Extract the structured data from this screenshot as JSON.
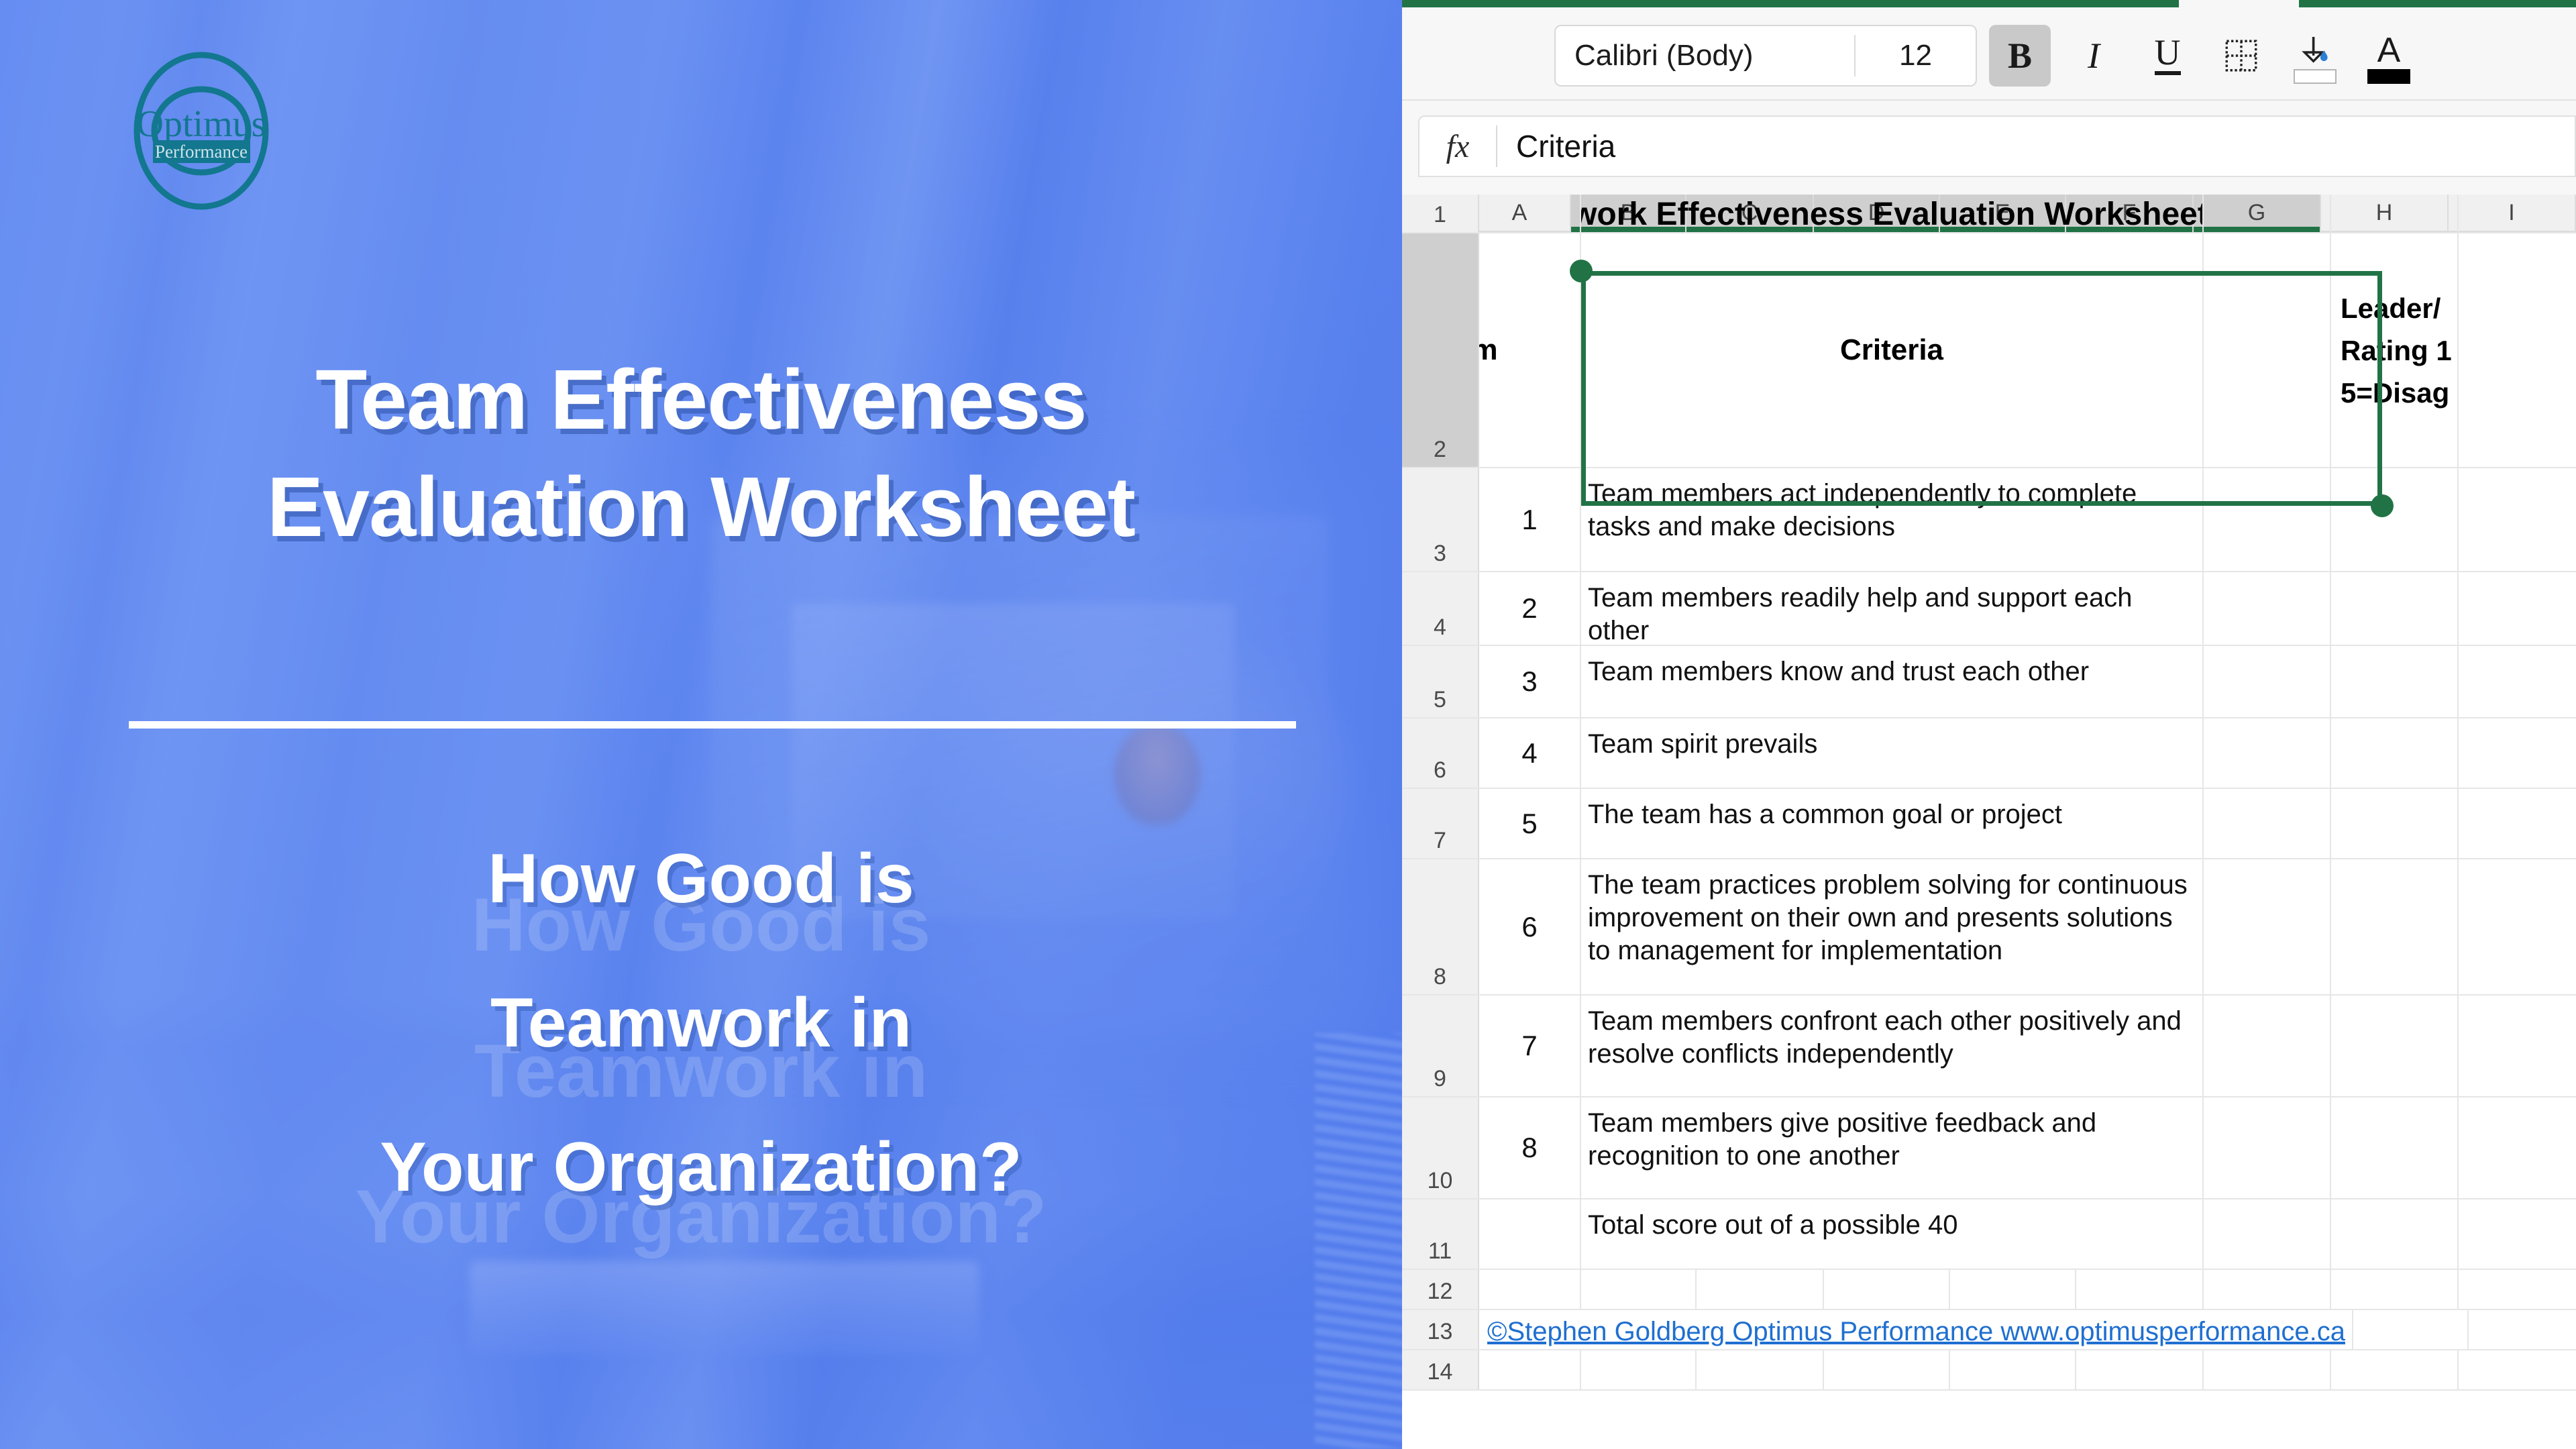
{
  "promo": {
    "logo": {
      "name_top": "Optimus",
      "name_bottom": "Performance",
      "color": "#12778f"
    },
    "title_line1": "Team Effectiveness",
    "title_line2": "Evaluation Worksheet",
    "subtitle_line1": "How Good is",
    "subtitle_line2": "Teamwork in",
    "subtitle_line3": "Your Organization?",
    "background_color": "#5b86f0"
  },
  "excel": {
    "ribbon_accent_color": "#217346",
    "toolbar": {
      "font_name": "Calibri (Body)",
      "font_size": "12",
      "bold_label": "B",
      "italic_label": "I",
      "underline_label": "U",
      "borders_label": "borders-icon",
      "fill_color_label": "fill-color-icon",
      "fill_swatch_color": "#ffffff",
      "font_color_label": "A",
      "font_color_swatch": "#000000",
      "bold_active": "true"
    },
    "formula_bar": {
      "fx_label": "fx",
      "value": "Criteria"
    },
    "columns": [
      "A",
      "B",
      "C",
      "D",
      "E",
      "F",
      "G",
      "H",
      "I"
    ],
    "selected_columns": [
      "B",
      "C",
      "D",
      "E",
      "F",
      "G"
    ],
    "row_numbers": [
      "1",
      "2",
      "3",
      "4",
      "5",
      "6",
      "7",
      "8",
      "9",
      "10",
      "11",
      "12",
      "13",
      "14"
    ],
    "sheet": {
      "title": "eamwork Effectiveness Evaluation Worksheet",
      "header_item": "em",
      "header_criteria": "Criteria",
      "header_rating_l1": "Leader/",
      "header_rating_l2": "Rating 1",
      "header_rating_l3": "5=Disag",
      "rows": [
        {
          "num": "1",
          "criteria": "Team members act independently to complete tasks and make decisions"
        },
        {
          "num": "2",
          "criteria": "Team members readily help and support each other"
        },
        {
          "num": "3",
          "criteria": "Team members know and trust each other"
        },
        {
          "num": "4",
          "criteria": "Team spirit prevails"
        },
        {
          "num": "5",
          "criteria": "The team has a common goal or project"
        },
        {
          "num": "6",
          "criteria": "The team practices problem solving for continuous improvement on their own and presents solutions to management for implementation"
        },
        {
          "num": "7",
          "criteria": "Team members confront each other positively and resolve conflicts independently"
        },
        {
          "num": "8",
          "criteria": "Team members give positive feedback and recognition to one another"
        }
      ],
      "total_row": "Total score out of a possible 40",
      "credit": "©Stephen Goldberg Optimus Performance www.optimusperformance.ca"
    }
  }
}
